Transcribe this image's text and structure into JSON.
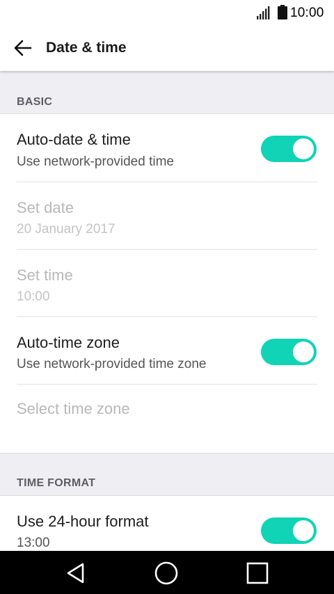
{
  "status_bar": {
    "time": "10:00",
    "icons": [
      "signal-icon",
      "battery-icon"
    ]
  },
  "app_bar": {
    "back_icon": "arrow-left-icon",
    "title": "Date & time"
  },
  "sections": {
    "basic": {
      "header": "BASIC",
      "auto_date_time": {
        "title": "Auto-date & time",
        "summary": "Use network-provided time",
        "enabled": true
      },
      "set_date": {
        "title": "Set date",
        "summary": "20 January 2017",
        "disabled": true
      },
      "set_time": {
        "title": "Set time",
        "summary": "10:00",
        "disabled": true
      },
      "auto_time_zone": {
        "title": "Auto-time zone",
        "summary": "Use network-provided time zone",
        "enabled": true
      },
      "select_time_zone": {
        "title": "Select time zone",
        "disabled": true
      }
    },
    "time_format": {
      "header": "TIME FORMAT",
      "use_24_hour": {
        "title": "Use 24-hour format",
        "summary": "13:00",
        "enabled": true
      }
    }
  },
  "colors": {
    "accent": "#11d3b6",
    "section_background": "#eeeef3",
    "nav_bar": "#000000"
  },
  "nav_bar": {
    "icons": [
      "back-triangle-icon",
      "home-circle-icon",
      "recents-square-icon"
    ]
  }
}
